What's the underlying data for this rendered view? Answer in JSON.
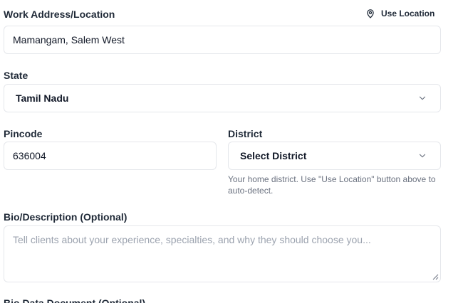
{
  "work_address": {
    "label": "Work Address/Location",
    "use_location_label": "Use Location",
    "value": "Mamangam, Salem West"
  },
  "state": {
    "label": "State",
    "selected": "Tamil Nadu"
  },
  "pincode": {
    "label": "Pincode",
    "value": "636004"
  },
  "district": {
    "label": "District",
    "selected": "Select District",
    "helper": "Your home district. Use \"Use Location\" button above to auto-detect."
  },
  "bio": {
    "label": "Bio/Description (Optional)",
    "placeholder": "Tell clients about your experience, specialties, and why they should choose you..."
  },
  "bio_data_document": {
    "label": "Bio Data Document (Optional)"
  },
  "icons": {
    "location": "map-pin-icon",
    "dropdown": "chevron-down-icon",
    "resize": "resize-handle-icon"
  }
}
